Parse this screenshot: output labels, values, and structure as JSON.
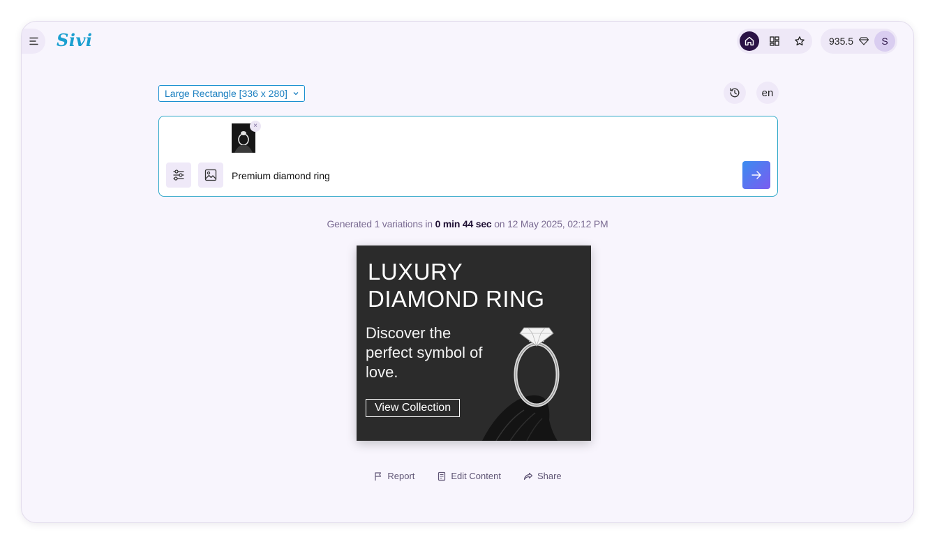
{
  "header": {
    "logo": "Sivi",
    "credits": "935.5",
    "avatar_initial": "S"
  },
  "toolbar": {
    "size_label": "Large Rectangle [336 x 280]",
    "language": "en"
  },
  "prompt": {
    "value": "Premium diamond ring",
    "placeholder": "",
    "remove_symbol": "×"
  },
  "generation": {
    "prefix": "Generated 1 variations in",
    "duration": "0 min 44 sec",
    "suffix": "on 12 May 2025, 02:12 PM"
  },
  "ad": {
    "headline_line1": "LUXURY",
    "headline_line2": "DIAMOND RING",
    "subtitle": "Discover the perfect symbol of love.",
    "cta": "View Collection",
    "background": "#2b2b2b"
  },
  "actions": {
    "report": "Report",
    "edit": "Edit Content",
    "share": "Share"
  },
  "colors": {
    "accent": "#1a8fd0",
    "send_gradient_start": "#3a8cf0",
    "send_gradient_end": "#7b5cf0",
    "nav_active": "#2a1245"
  },
  "icons": [
    "menu-icon",
    "home-icon",
    "apps-grid-icon",
    "star-icon",
    "diamond-icon",
    "chevron-down-icon",
    "history-icon",
    "sliders-icon",
    "image-icon",
    "arrow-right-icon",
    "flag-icon",
    "document-icon",
    "share-icon"
  ]
}
